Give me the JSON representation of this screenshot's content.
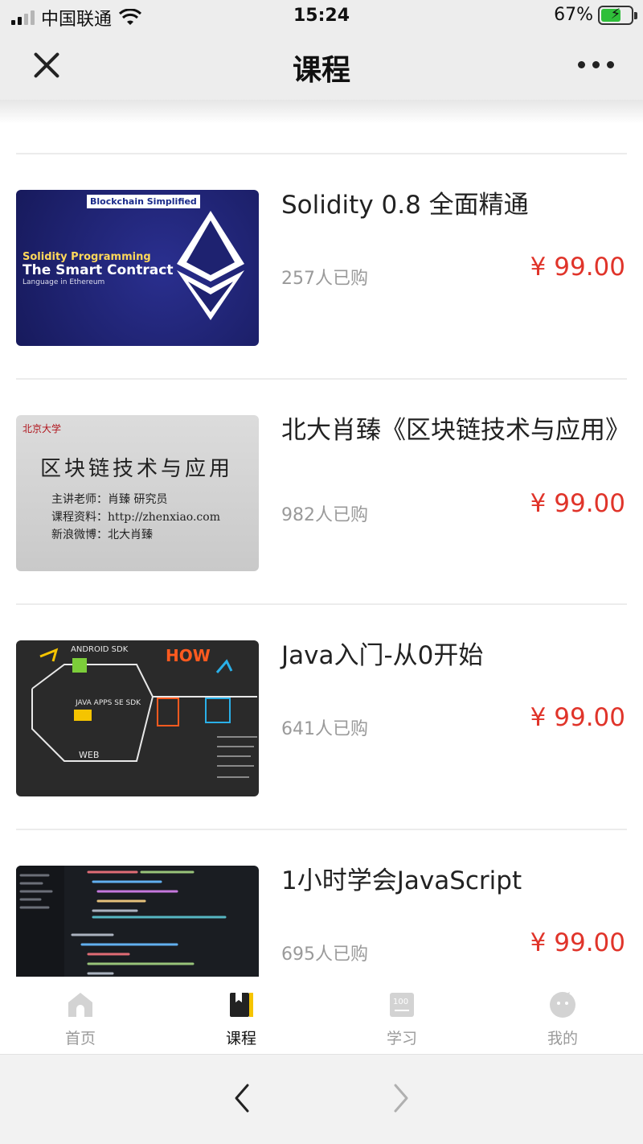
{
  "status_bar": {
    "carrier": "中国联通",
    "time": "15:24",
    "battery": "67%",
    "battery_level": 0.67
  },
  "nav": {
    "title": "课程",
    "close_icon": "close-icon",
    "more_icon": "more-icon"
  },
  "courses": [
    {
      "title": "Solidity 0.8 全面精通",
      "sold": "257人已购",
      "price": "¥ 99.00",
      "thumb": {
        "badge": "Blockchain Simplified",
        "line1": "Solidity Programming",
        "line2": "The Smart Contract",
        "line3": "Language in Ethereum"
      }
    },
    {
      "title": "北大肖臻《区块链技术与应用》",
      "sold": "982人已购",
      "price": "¥ 99.00",
      "thumb": {
        "logo": "北京大学",
        "heading": "区块链技术与应用",
        "line1": "主讲老师：肖臻 研究员",
        "line2": "课程资料：http://zhenxiao.com",
        "line3": "新浪微博：北大肖臻"
      }
    },
    {
      "title": "Java入门-从0开始",
      "sold": "641人已购",
      "price": "¥ 99.00",
      "thumb": {
        "how": "HOW",
        "android": "ANDROID SDK",
        "java": "JAVA APPS SE SDK",
        "web": "WEB"
      }
    },
    {
      "title": "1小时学会JavaScript",
      "sold": "695人已购",
      "price": "¥ 99.00",
      "thumb": {}
    }
  ],
  "tabs": [
    {
      "label": "首页",
      "icon": "home-icon",
      "active": false
    },
    {
      "label": "课程",
      "icon": "book-icon",
      "active": true
    },
    {
      "label": "学习",
      "icon": "study-icon",
      "active": false
    },
    {
      "label": "我的",
      "icon": "profile-icon",
      "active": false
    }
  ],
  "colors": {
    "price": "#e0342a",
    "accent": "#f5c400",
    "nav_bg": "#ededed"
  }
}
